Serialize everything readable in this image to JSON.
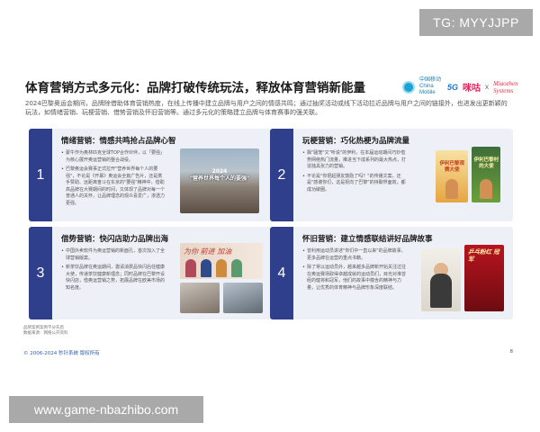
{
  "overlay": {
    "tg_badge": "TG: MYYJJPP",
    "url_badge": "www.game-nbazhibo.com"
  },
  "slide": {
    "title": "体育营销方式多元化：品牌打破传统玩法，释放体育营销新能量",
    "logos": {
      "china_mobile": "中国移动 China Mobile",
      "five_g": "5G",
      "migu": "咪咕",
      "x": "x",
      "miaozhen": "Miaozhen Systems"
    },
    "intro": "2024巴黎奥运会期间，品牌除借助体育营销热度，在线上传播中建立品牌与用户之间的情感共鸣；通过抽奖活动或线下活动拉近品牌与用户之间的链接外，也进发出更新颖的玩法，如情绪营销、玩梗营销、借势营销及怀旧营销等。通过多元化的策略建立品牌与体育赛事的强关联。",
    "cards": [
      {
        "number": "1",
        "title": "情绪营销：情感共鸣抢占品牌心智",
        "bullets": [
          "蒙牛作为奥林匹克全球TOP合作伙伴，以「要强」为核心展开奥运营销的整合战役。",
          "巴黎奥运会赛事正式拉开\"营养世界每个人的要强\"，不论是《开幕》奥运会全篇广告片，还是携手赞助、远距离奋斗在东京的\"要强\"精神中，借助高品牌在大赛期间的时间，又体现了品牌对每一个普通人的关怀，让品牌理念的观众喜爱广，渗透力更强。"
        ],
        "image_caption_year": "2024",
        "image_caption": "\"营养世界每个人的要强\""
      },
      {
        "number": "2",
        "title": "玩梗营销：巧化热梗为品牌流量",
        "bullets": [
          "飘\"骚笼\"又\"听说\"的伊利，在本届运动期间巧妙借势网络热门流量，推进当下成系列的最大热点，打造独具张力的营销。",
          "不论是\"你把起朋友鼓励了吗？\"的传播文案，还是\"感谢你们，这是祝向了巴黎\"的持聊界面效，都成功破圈。"
        ],
        "poster1": "伊利巴黎观赛大使",
        "poster2": "伊利巴黎村的大使"
      },
      {
        "number": "3",
        "title": "借势营销：快闪店助力品牌出海",
        "bullets": [
          "中国外卖软件为奥运营销的新面孔，首次加入了全球营销版案。",
          "新茶饮品牌在奥运期间，邀请消费品快闪后任健康大使，传递茶饮健康新理念；同时品牌在巴黎开设快闪店，借奥运营销之势，拓展品牌在欧美市场的知名度。"
        ],
        "banner_text": "为你 前进 加油"
      },
      {
        "number": "4",
        "title": "怀旧营销：建立情感联结讲好品牌故事",
        "bullets": [
          "曾利用运动员讲述\"你们中一直以来\"的品牌故事，更多品牌在运营的重点书籍。",
          "除了常以运动员外，越来越多品牌新开始关注过往在奥运赛场取得卓越成就的运动员们，目光对准曾经的健将和冠军，他们的故事中蕴含的精神与力量，让优秀的体育精神与品牌形象深度联结。"
        ],
        "poster_red": "乒乓粉红 冠军"
      }
    ],
    "foot_notes": [
      "品牌案例案例不分先后",
      "数据来源：网络公开资料"
    ],
    "copyright": "© 2006-2024 秒针系统 版权所有",
    "page_number": "8"
  },
  "colors": {
    "accent": "#2f3f8c",
    "card_bg": "#eef0f7",
    "link": "#2f5fa8"
  }
}
